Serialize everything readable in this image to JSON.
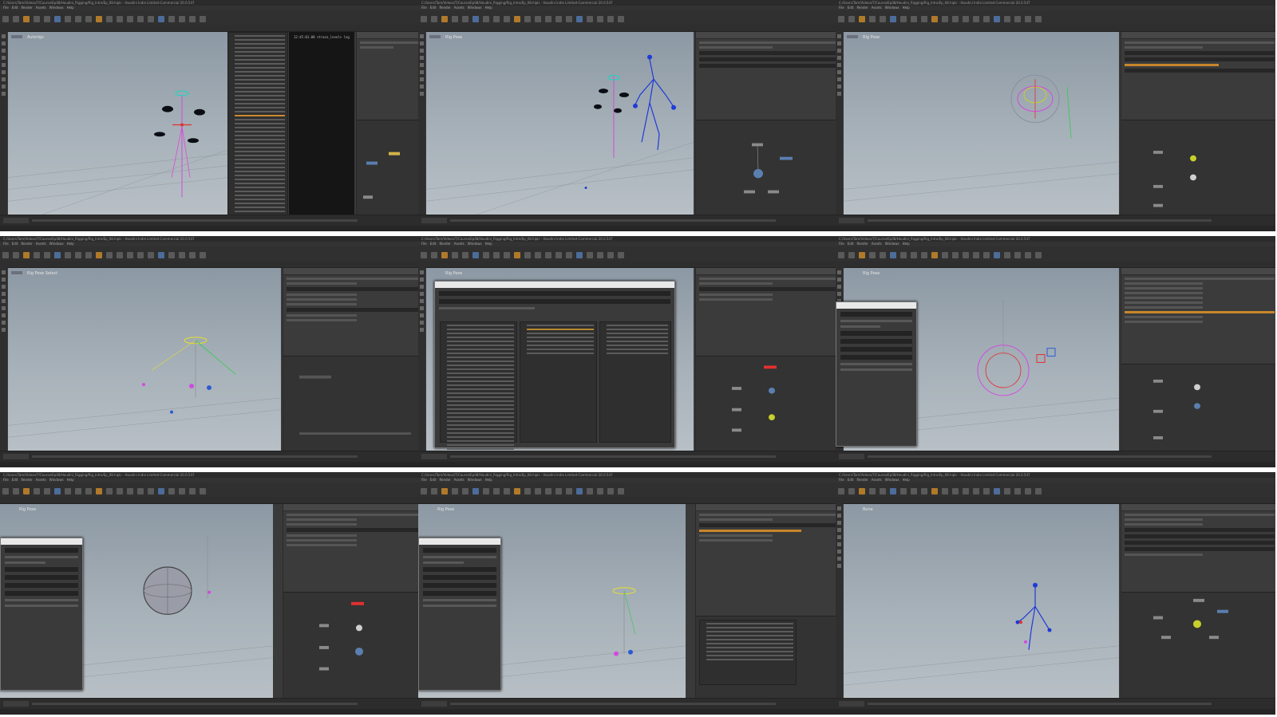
{
  "frames": [
    {
      "title": "C:/Users/Tam/Videos/T/Course/Ep08/Houdini_Rigging/Rig_Intro/Ep_08.hiplc - Houdini Indie Limited-Commercial 20.0.547",
      "viewport_label": "Autorigs"
    },
    {
      "title": "C:/Users/Tam/Videos/T/Course/Ep08/Houdini_Rigging/Rig_Intro/Ep_08.hiplc - Houdini Indie Limited-Commercial 20.0.547",
      "viewport_label": "Rig Pose"
    },
    {
      "title": "C:/Users/Tam/Videos/T/Course/Ep08/Houdini_Rigging/Rig_Intro/Ep_08.hiplc - Houdini Indie Limited-Commercial 20.0.547",
      "viewport_label": "Rig Pose"
    },
    {
      "title": "C:/Users/Tam/Videos/T/Course/Ep08/Houdini_Rigging/Rig_Intro/Ep_08.hiplc - Houdini Indie Limited-Commercial 20.0.547",
      "viewport_label": "Rig Pose Select"
    },
    {
      "title": "C:/Users/Tam/Videos/T/Course/Ep08/Houdini_Rigging/Rig_Intro/Ep_08.hiplc - Houdini Indie Limited-Commercial 20.0.547",
      "viewport_label": "Rig Pose"
    },
    {
      "title": "C:/Users/Tam/Videos/T/Course/Ep08/Houdini_Rigging/Rig_Intro/Ep_08.hiplc - Houdini Indie Limited-Commercial 20.0.547",
      "viewport_label": "Rig Pose"
    },
    {
      "title": "C:/Users/Tam/Videos/T/Course/Ep08/Houdini_Rigging/Rig_Intro/Ep_08.hiplc - Houdini Indie Limited-Commercial 20.0.547",
      "viewport_label": "Rig Pose"
    },
    {
      "title": "C:/Users/Tam/Videos/T/Course/Ep08/Houdini_Rigging/Rig_Intro/Ep_08.hiplc - Houdini Indie Limited-Commercial 20.0.547",
      "viewport_label": "Rig Pose"
    },
    {
      "title": "C:/Users/Tam/Videos/T/Course/Ep08/Houdini_Rigging/Rig_Intro/Ep_08.hiplc - Houdini Indie Limited-Commercial 20.0.547",
      "viewport_label": "Bone"
    }
  ],
  "menu": [
    "File",
    "Edit",
    "Render",
    "Assets",
    "Windows",
    "Help"
  ],
  "console_lines": [
    "12:45:01.00  <trace_level> log",
    "12:45:01.04  <trace_level> log"
  ],
  "colors": {
    "accent": "#c8862a",
    "viewport_top": "#8c98a3",
    "viewport_bottom": "#b8c0c6",
    "panel": "#3a3a3a"
  }
}
